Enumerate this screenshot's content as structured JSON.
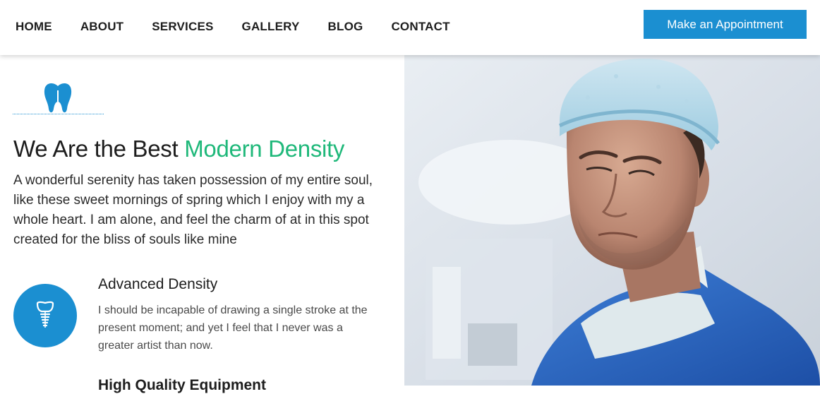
{
  "nav": {
    "items": [
      "HOME",
      "ABOUT",
      "SERVICES",
      "GALLERY",
      "BLOG",
      "CONTACT"
    ],
    "cta_label": "Make an Appointment"
  },
  "hero": {
    "headline_main": "We Are the Best ",
    "headline_accent": "Modern Density",
    "intro": "A wonderful serenity has taken possession of my entire soul, like these sweet mornings of spring which I enjoy with my a whole heart. I am alone, and feel the charm of at in this spot created for the bliss of souls like mine"
  },
  "features": [
    {
      "title": "Advanced Density",
      "text": "I should be incapable of drawing a single stroke at the present moment; and yet I feel that I never was a greater artist than now.",
      "icon": "dental-implant-icon"
    },
    {
      "title": "High Quality Equipment",
      "icon": ""
    }
  ],
  "colors": {
    "accent_blue": "#1b8fd1",
    "accent_green": "#1fb87a"
  }
}
